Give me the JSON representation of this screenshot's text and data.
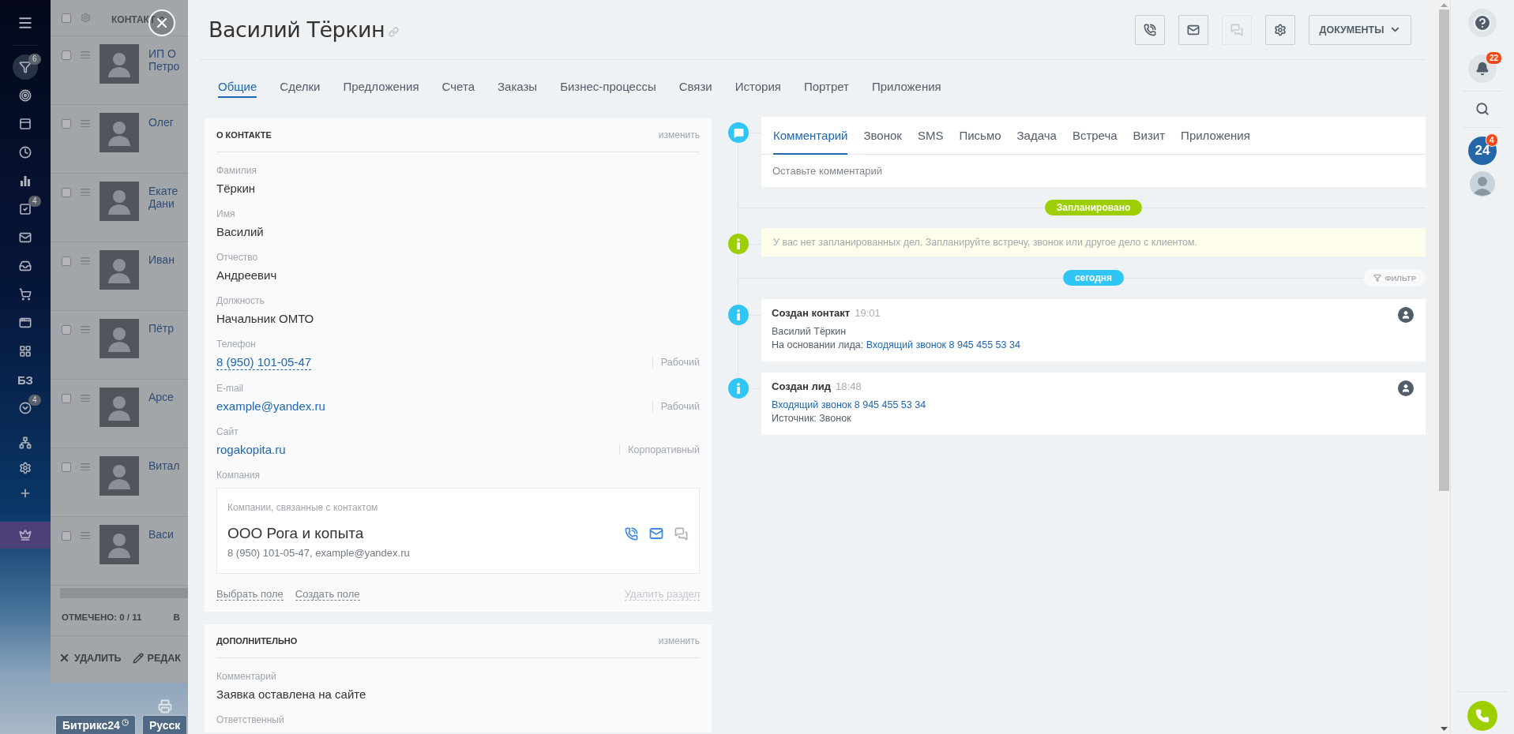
{
  "backdrop": {
    "nav": {
      "items": [
        {
          "selected": false
        },
        {
          "selected": true,
          "badge": "6"
        },
        {
          "selected": false
        },
        {
          "selected": false
        },
        {
          "selected": false
        },
        {
          "selected": false
        },
        {
          "selected": false,
          "badge": "4"
        },
        {
          "selected": false
        },
        {
          "selected": false
        },
        {
          "selected": false
        },
        {
          "selected": false
        },
        {
          "selected": false
        },
        {
          "selected": false,
          "label": "БЗ"
        },
        {
          "selected": false,
          "badge": "4"
        },
        {
          "selected": false
        },
        {
          "selected": false
        },
        {
          "selected": false
        },
        {
          "selected": false
        }
      ]
    },
    "list": {
      "header": "КОНТАКТ",
      "all_checked": false,
      "rows": [
        {
          "checked": false,
          "name": [
            "ИП О",
            "Петро"
          ]
        },
        {
          "checked": false,
          "name": [
            "Олег"
          ]
        },
        {
          "checked": false,
          "name": [
            "Екате",
            "Дани"
          ]
        },
        {
          "checked": false,
          "name": [
            "Иван"
          ]
        },
        {
          "checked": false,
          "name": [
            "Пётр"
          ]
        },
        {
          "checked": false,
          "name": [
            "Арсе"
          ]
        },
        {
          "checked": false,
          "name": [
            "Витал"
          ]
        },
        {
          "checked": false,
          "name": [
            "Васи"
          ]
        }
      ],
      "footer": {
        "marked": "ОТМЕЧЕНО: 0 / 11",
        "column_2": "В"
      },
      "actions": [
        "УДАЛИТЬ",
        "РЕДАК"
      ]
    },
    "bottom_buttons": [
      "Битрикс24",
      "Русск"
    ]
  },
  "header": {
    "title": "Василий Тёркин",
    "buttons": [
      {
        "disabled": false
      },
      {
        "disabled": false
      },
      {
        "disabled": true
      },
      {
        "disabled": false
      }
    ],
    "documents": "ДОКУМЕНТЫ"
  },
  "tabs": [
    {
      "label": "Общие",
      "selected": true
    },
    {
      "label": "Сделки",
      "selected": false
    },
    {
      "label": "Предложения",
      "selected": false
    },
    {
      "label": "Счета",
      "selected": false
    },
    {
      "label": "Заказы",
      "selected": false
    },
    {
      "label": "Бизнес-процессы",
      "selected": false
    },
    {
      "label": "Связи",
      "selected": false
    },
    {
      "label": "История",
      "selected": false
    },
    {
      "label": "Портрет",
      "selected": false
    },
    {
      "label": "Приложения",
      "selected": false
    }
  ],
  "contact_card": {
    "title": "О КОНТАКТЕ",
    "edit": "изменить",
    "fields": [
      {
        "kind": "text",
        "label": "Фамилия",
        "value": "Тёркин"
      },
      {
        "kind": "text",
        "label": "Имя",
        "value": "Василий"
      },
      {
        "kind": "text",
        "label": "Отчество",
        "value": "Андреевич"
      },
      {
        "kind": "text",
        "label": "Должность",
        "value": "Начальник ОМТО"
      },
      {
        "kind": "phone",
        "label": "Телефон",
        "value": "8 (950) 101-05-47",
        "type": "Рабочий"
      },
      {
        "kind": "link",
        "label": "E-mail",
        "value": "example@yandex.ru",
        "type": "Рабочий"
      },
      {
        "kind": "link",
        "label": "Сайт",
        "value": "rogakopita.ru",
        "type": "Корпоративный"
      }
    ],
    "company": {
      "label": "Компания",
      "caption": "Компании, связанные с контактом",
      "name": "ООО Рога и копыта",
      "details": "8 (950) 101-05-47, example@yandex.ru"
    },
    "links": [
      "Выбрать поле",
      "Создать поле"
    ],
    "delete": "Удалить раздел"
  },
  "extra_card": {
    "title": "ДОПОЛНИТЕЛЬНО",
    "edit": "изменить",
    "fields": [
      {
        "label": "Комментарий",
        "value": "Заявка оставлена на сайте"
      },
      {
        "label": "Ответственный"
      }
    ]
  },
  "timeline": {
    "composer": {
      "tabs": [
        {
          "label": "Комментарий",
          "selected": true
        },
        {
          "label": "Звонок",
          "selected": false
        },
        {
          "label": "SMS",
          "selected": false
        },
        {
          "label": "Письмо",
          "selected": false
        },
        {
          "label": "Задача",
          "selected": false
        },
        {
          "label": "Встреча",
          "selected": false
        },
        {
          "label": "Визит",
          "selected": false
        },
        {
          "label": "Приложения",
          "selected": false
        }
      ],
      "placeholder": "Оставьте комментарий"
    },
    "planned": {
      "label": "Запланировано",
      "note": "У вас нет запланированных дел. Запланируйте встречу, звонок или другое дело с клиентом."
    },
    "today": {
      "label": "сегодня",
      "filter": "ФИЛЬТР"
    },
    "events": [
      {
        "title": "Создан контакт",
        "time": "19:01",
        "lines": [
          {
            "text": "Василий Тёркин"
          },
          {
            "text": "На основании лида: ",
            "link": "Входящий звонок 8 945 455 53 34"
          }
        ]
      },
      {
        "title": "Создан лид",
        "time": "18:48",
        "lines": [
          {
            "link": "Входящий звонок 8 945 455 53 34"
          },
          {
            "text": "Источник: Звонок"
          }
        ]
      }
    ]
  },
  "right_bar": {
    "notifications_badge": "22",
    "logo": {
      "label": "24",
      "badge": "4"
    }
  }
}
